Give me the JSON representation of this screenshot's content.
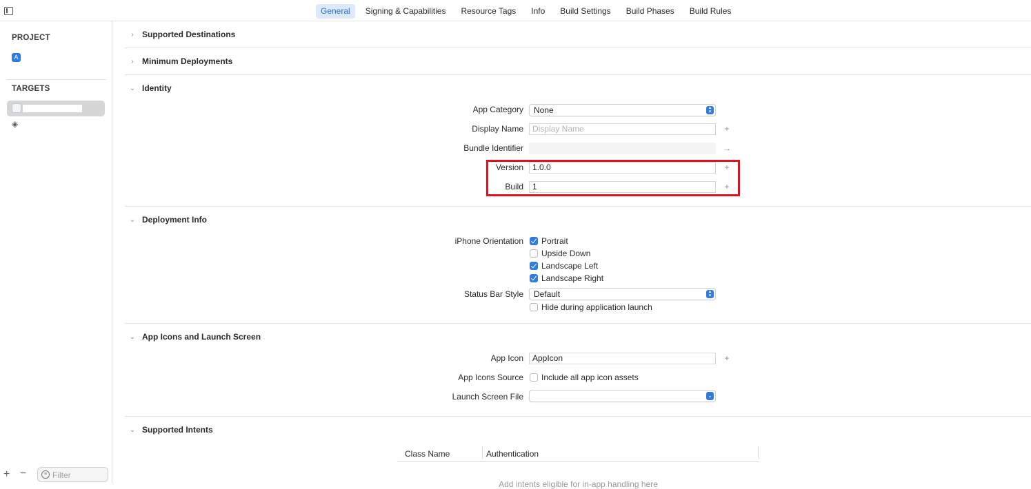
{
  "toolbar": {
    "tabs": [
      {
        "label": "General",
        "active": true
      },
      {
        "label": "Signing & Capabilities"
      },
      {
        "label": "Resource Tags"
      },
      {
        "label": "Info"
      },
      {
        "label": "Build Settings"
      },
      {
        "label": "Build Phases"
      },
      {
        "label": "Build Rules"
      }
    ]
  },
  "sidebar": {
    "project_heading": "PROJECT",
    "targets_heading": "TARGETS",
    "filter_placeholder": "Filter"
  },
  "sections": {
    "supported_destinations": "Supported Destinations",
    "minimum_deployments": "Minimum Deployments",
    "identity": "Identity",
    "deployment_info": "Deployment Info",
    "app_icons": "App Icons and Launch Screen",
    "supported_intents": "Supported Intents"
  },
  "identity": {
    "app_category_label": "App Category",
    "app_category_value": "None",
    "display_name_label": "Display Name",
    "display_name_placeholder": "Display Name",
    "bundle_identifier_label": "Bundle Identifier",
    "version_label": "Version",
    "version_value": "1.0.0",
    "build_label": "Build",
    "build_value": "1"
  },
  "deployment": {
    "orientation_label": "iPhone Orientation",
    "orientations": [
      {
        "label": "Portrait",
        "checked": true
      },
      {
        "label": "Upside Down",
        "checked": false
      },
      {
        "label": "Landscape Left",
        "checked": true
      },
      {
        "label": "Landscape Right",
        "checked": true
      }
    ],
    "status_bar_label": "Status Bar Style",
    "status_bar_value": "Default",
    "hide_launch_label": "Hide during application launch",
    "hide_launch_checked": false
  },
  "app_icons": {
    "app_icon_label": "App Icon",
    "app_icon_value": "AppIcon",
    "source_label": "App Icons Source",
    "source_checkbox_label": "Include all app icon assets",
    "source_checked": false,
    "launch_label": "Launch Screen File",
    "launch_value": ""
  },
  "intents": {
    "col_class": "Class Name",
    "col_auth": "Authentication",
    "empty_message": "Add intents eligible for in-app handling here"
  },
  "colors": {
    "accent": "#2f7ae5",
    "highlight": "#e3101c",
    "active_tab_bg": "#dbe9fb"
  }
}
